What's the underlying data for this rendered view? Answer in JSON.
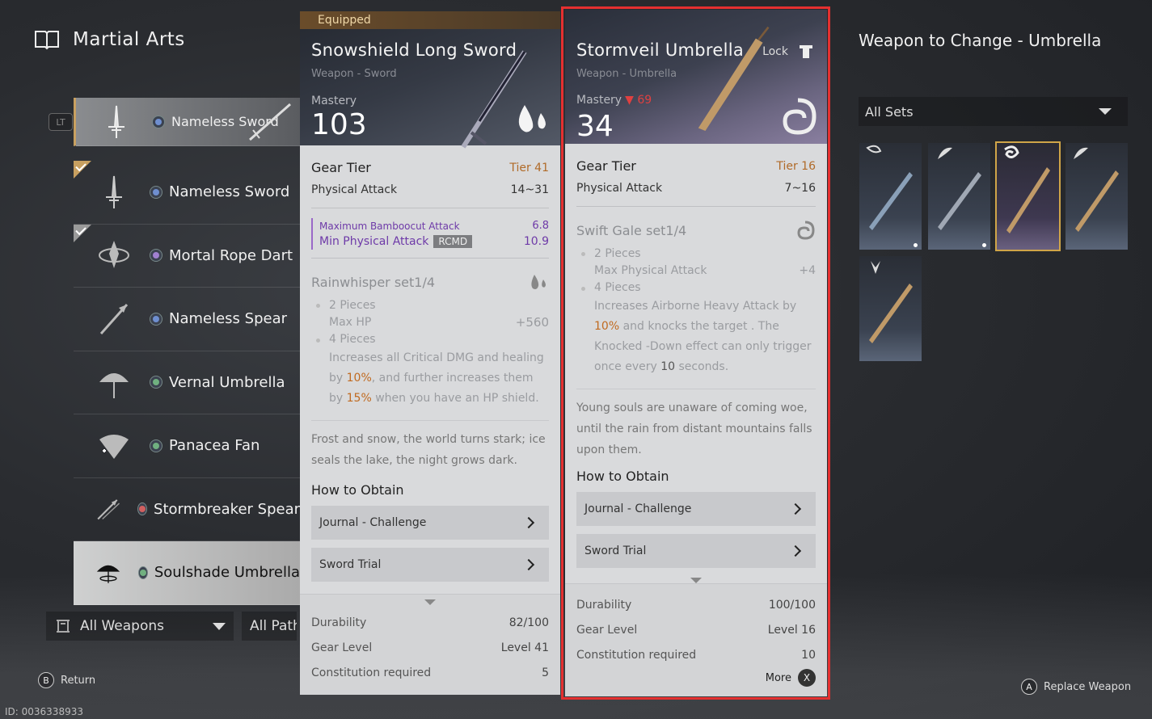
{
  "header": {
    "title": "Martial Arts"
  },
  "weapon_list": [
    {
      "name": "Nameless Sword",
      "state": "active"
    },
    {
      "name": "Nameless Sword",
      "state": "equipped"
    },
    {
      "name": "Mortal Rope Dart",
      "state": "checked"
    },
    {
      "name": "Nameless Spear",
      "state": ""
    },
    {
      "name": "Vernal Umbrella",
      "state": ""
    },
    {
      "name": "Panacea Fan",
      "state": ""
    },
    {
      "name": "Stormbreaker Spear",
      "state": ""
    },
    {
      "name": "Soulshade Umbrella",
      "state": "highlighted"
    }
  ],
  "lt_label": "LT",
  "filters": {
    "weapons": "All Weapons",
    "paths": "All Paths"
  },
  "hints": {
    "return_key": "B",
    "return_label": "Return",
    "replace_key": "A",
    "replace_label": "Replace Weapon"
  },
  "id_text": "ID: 0036338933",
  "equipped_card": {
    "tag": "Equipped",
    "name": "Snowshield Long Sword",
    "type": "Weapon - Sword",
    "mastery_label": "Mastery",
    "mastery": "103",
    "gear_tier_label": "Gear Tier",
    "gear_tier": "Tier 41",
    "phys_label": "Physical Attack",
    "phys": "14~31",
    "bonuses": [
      {
        "label": "Maximum Bamboocut Attack",
        "value": "6.8"
      },
      {
        "label": "Min Physical Attack",
        "badge": "RCMD",
        "value": "10.9"
      }
    ],
    "set_title": "Rainwhisper set1/4",
    "set2_label": "2 Pieces",
    "set2_stat": "Max HP",
    "set2_value": "+560",
    "set4_label": "4 Pieces",
    "set4_text1": "Increases all Critical DMG and healing by",
    "set4_pct1": "10%",
    "set4_text2": ", and further increases them by",
    "set4_pct2": "15%",
    "set4_text3": "when you have an HP shield.",
    "flavor": "Frost and snow, the world turns stark; ice seals the lake, the night grows dark.",
    "how_to_obtain": "How to Obtain",
    "obtain": [
      "Journal - Challenge",
      "Sword Trial"
    ],
    "durability_label": "Durability",
    "durability": "82/100",
    "gear_level_label": "Gear Level",
    "gear_level": "Level 41",
    "constitution_label": "Constitution required",
    "constitution": "5"
  },
  "compare_card": {
    "name": "Stormveil Umbrella",
    "lock_label": "Lock",
    "type": "Weapon - Umbrella",
    "mastery_label": "Mastery",
    "mastery_delta": "69",
    "mastery": "34",
    "gear_tier_label": "Gear Tier",
    "gear_tier": "Tier 16",
    "phys_label": "Physical Attack",
    "phys": "7~16",
    "set_title": "Swift Gale set1/4",
    "set2_label": "2 Pieces",
    "set2_stat": "Max Physical Attack",
    "set2_value": "+4",
    "set4_label": "4 Pieces",
    "set4_text1": "Increases Airborne Heavy Attack by",
    "set4_pct1": "10%",
    "set4_text2": "and knocks the target . The Knocked -Down effect can only trigger once every",
    "set4_num": "10",
    "set4_text3": "seconds.",
    "flavor": "Young souls are unaware of coming woe, until the rain from distant mountains falls upon them.",
    "how_to_obtain": "How to Obtain",
    "obtain": [
      "Journal - Challenge",
      "Sword Trial"
    ],
    "durability_label": "Durability",
    "durability": "100/100",
    "gear_level_label": "Gear Level",
    "gear_level": "Level 16",
    "constitution_label": "Constitution required",
    "constitution": "10",
    "more_label": "More",
    "more_key": "X"
  },
  "right_panel": {
    "title": "Weapon to Change - Umbrella",
    "sets_dropdown": "All Sets"
  },
  "colors": {
    "accent_gold": "#c8a060",
    "tier": "#b06a28",
    "bonus_purple": "#6e3aa8",
    "delta_red": "#e04040",
    "highlight_red": "#e53030"
  }
}
